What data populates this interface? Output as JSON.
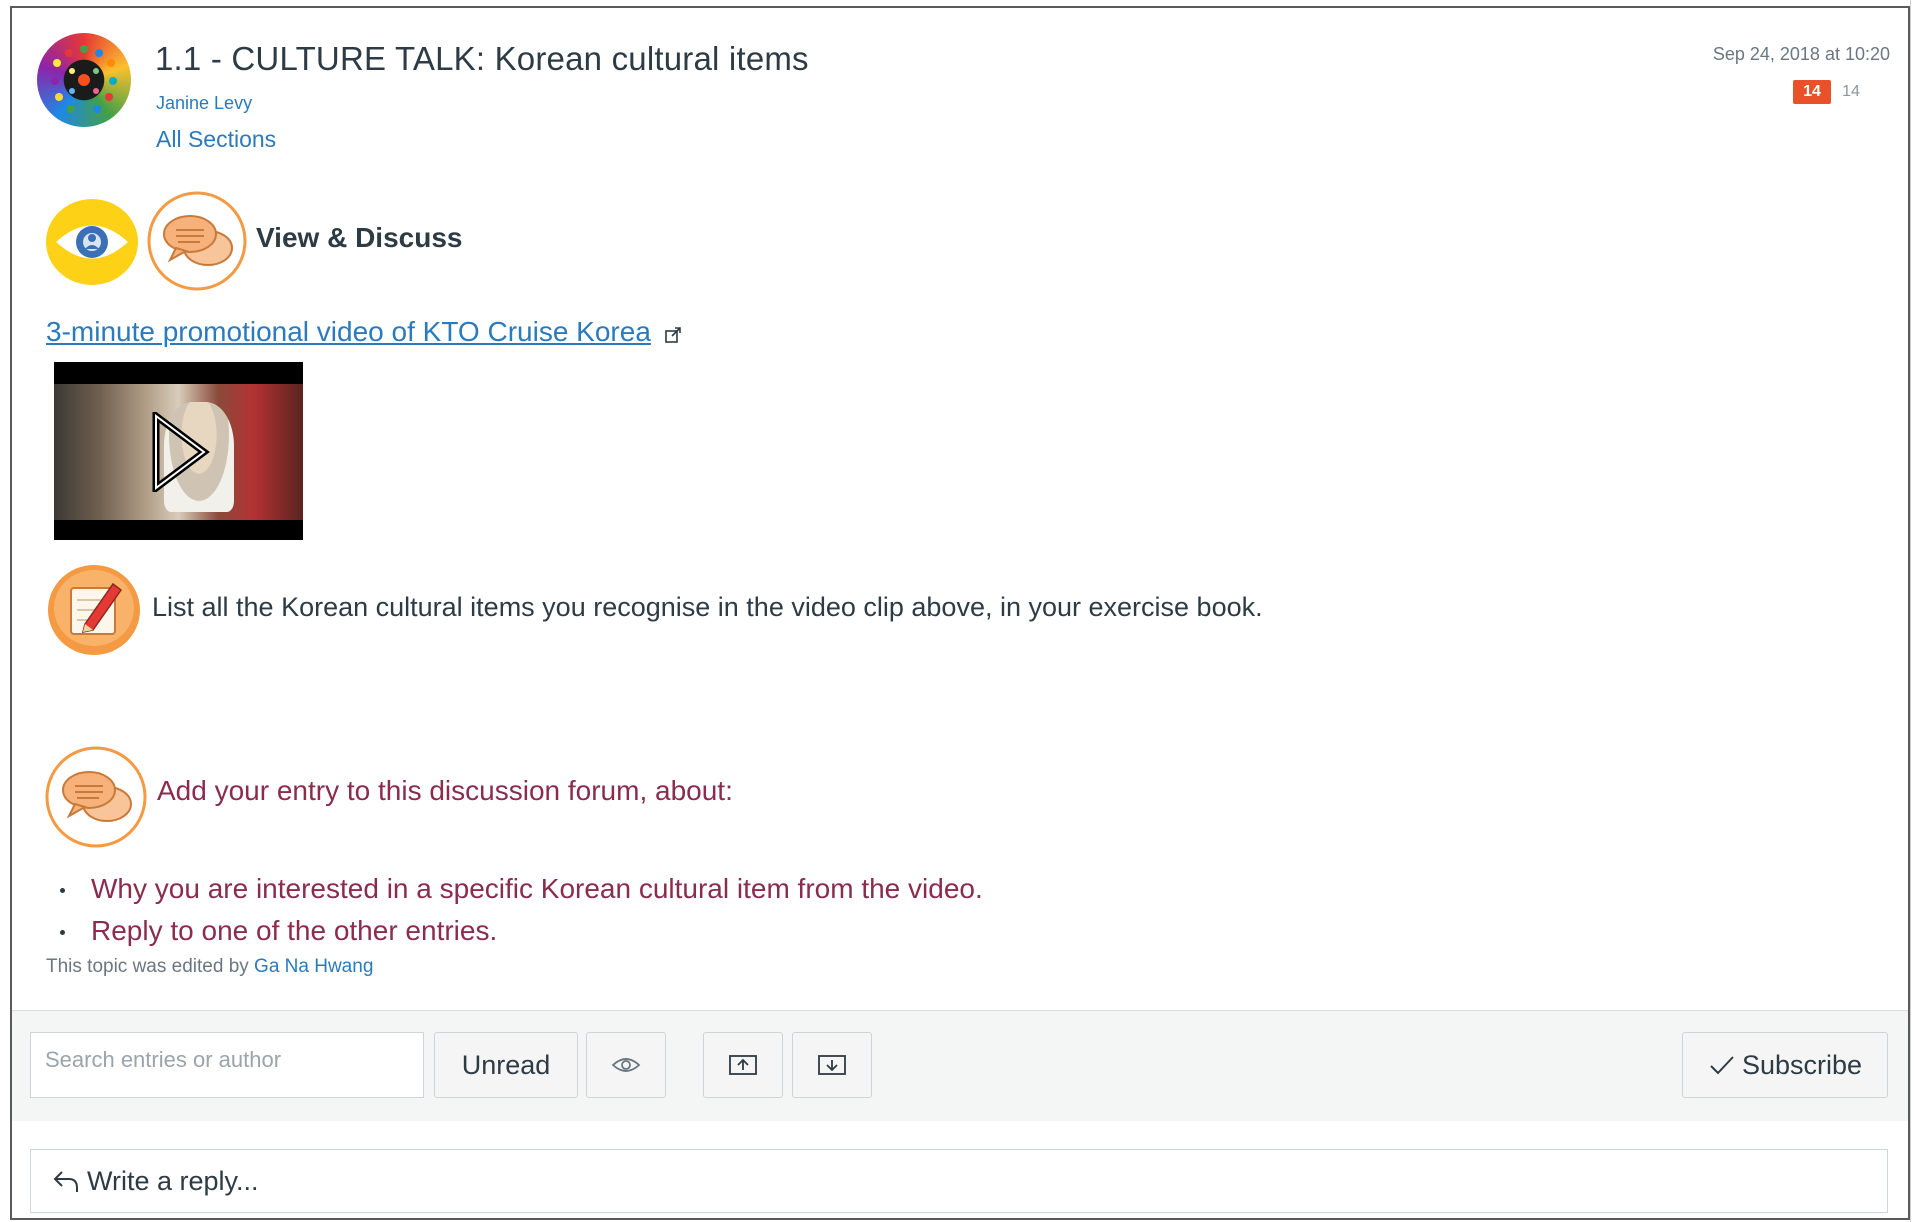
{
  "topic": {
    "title": "1.1 - CULTURE TALK: Korean cultural items",
    "author": "Janine Levy",
    "sections": "All Sections",
    "posted_at": "Sep 24, 2018 at 10:20",
    "unread_count": "14",
    "total_count": "14"
  },
  "content": {
    "view_discuss": "View & Discuss",
    "video_link": "3-minute promotional video of KTO Cruise Korea",
    "instruction": "List all the Korean cultural items you recognise in the video clip above, in your exercise book.",
    "add_entry": "Add your entry to this discussion forum, about:",
    "bullets": [
      "Why you are interested in a specific Korean cultural item from the video.",
      "Reply to one of the other entries."
    ],
    "edited_prefix": "This topic was edited by",
    "edited_by": "Ga Na Hwang"
  },
  "toolbar": {
    "search_placeholder": "Search entries or author",
    "unread_label": "Unread",
    "subscribe_label": "Subscribe"
  },
  "reply": {
    "placeholder": "Write a reply..."
  },
  "icons": [
    "eye-icon",
    "speech-bubbles-icon",
    "external-link-icon",
    "play-icon",
    "pencil-notepad-icon",
    "show-hide-eye-icon",
    "collapse-icon",
    "expand-icon",
    "checkmark-icon",
    "reply-arrow-icon"
  ],
  "colors": {
    "link": "#2b7abc",
    "accent_text": "#8b2c4b",
    "badge": "#e8512a",
    "icon_ring": "#f39a43"
  }
}
